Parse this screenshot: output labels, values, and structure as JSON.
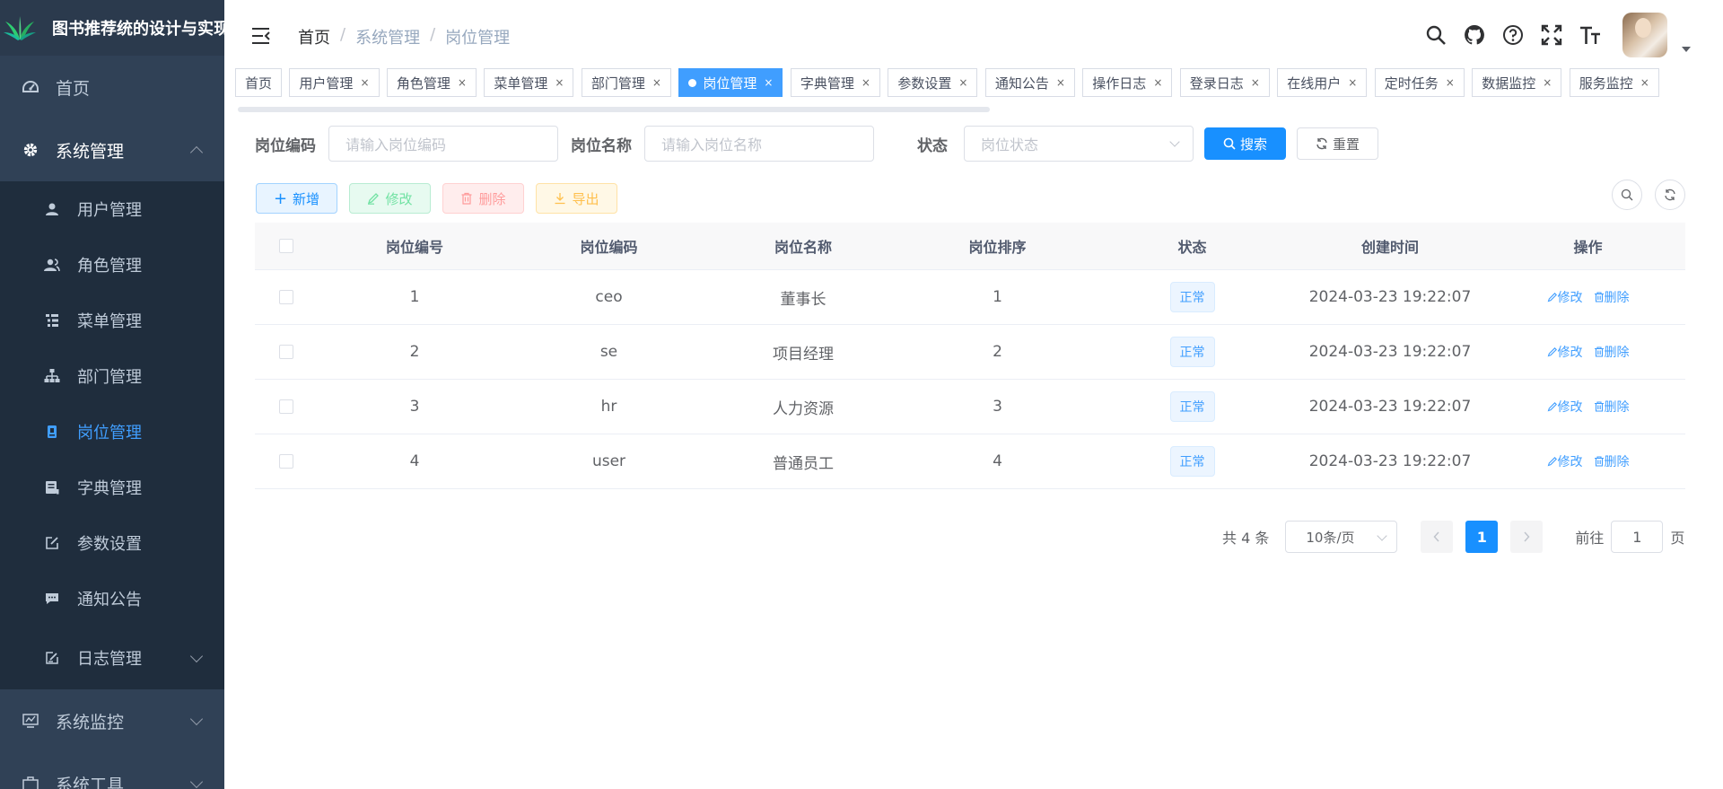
{
  "app": {
    "title": "图书推荐统的设计与实现"
  },
  "sidebar": {
    "items": [
      {
        "label": "首页"
      },
      {
        "label": "系统管理"
      },
      {
        "label": "系统监控"
      },
      {
        "label": "系统工具"
      }
    ],
    "sub_items": [
      {
        "label": "用户管理"
      },
      {
        "label": "角色管理"
      },
      {
        "label": "菜单管理"
      },
      {
        "label": "部门管理"
      },
      {
        "label": "岗位管理"
      },
      {
        "label": "字典管理"
      },
      {
        "label": "参数设置"
      },
      {
        "label": "通知公告"
      },
      {
        "label": "日志管理"
      }
    ]
  },
  "breadcrumb": [
    "首页",
    "/",
    "系统管理",
    "/",
    "岗位管理"
  ],
  "tags": [
    "首页",
    "用户管理",
    "角色管理",
    "菜单管理",
    "部门管理",
    "岗位管理",
    "字典管理",
    "参数设置",
    "通知公告",
    "操作日志",
    "登录日志",
    "在线用户",
    "定时任务",
    "数据监控",
    "服务监控"
  ],
  "tag_close": "×",
  "search": {
    "code_label": "岗位编码",
    "code_placeholder": "请输入岗位编码",
    "name_label": "岗位名称",
    "name_placeholder": "请输入岗位名称",
    "status_label": "状态",
    "status_placeholder": "岗位状态",
    "search_btn": "搜索",
    "reset_btn": "重置"
  },
  "toolbar": {
    "add": "新增",
    "edit": "修改",
    "delete": "删除",
    "export": "导出"
  },
  "table": {
    "headers": [
      "岗位编号",
      "岗位编码",
      "岗位名称",
      "岗位排序",
      "状态",
      "创建时间",
      "操作"
    ],
    "rows": [
      {
        "id": "1",
        "code": "ceo",
        "name": "董事长",
        "sort": "1",
        "status": "正常",
        "created": "2024-03-23 19:22:07"
      },
      {
        "id": "2",
        "code": "se",
        "name": "项目经理",
        "sort": "2",
        "status": "正常",
        "created": "2024-03-23 19:22:07"
      },
      {
        "id": "3",
        "code": "hr",
        "name": "人力资源",
        "sort": "3",
        "status": "正常",
        "created": "2024-03-23 19:22:07"
      },
      {
        "id": "4",
        "code": "user",
        "name": "普通员工",
        "sort": "4",
        "status": "正常",
        "created": "2024-03-23 19:22:07"
      }
    ],
    "op_edit": "修改",
    "op_delete": "删除"
  },
  "pagination": {
    "total": "共 4 条",
    "page_size": "10条/页",
    "current": "1",
    "goto_prefix": "前往",
    "goto_value": "1",
    "goto_suffix": "页"
  },
  "colors": {
    "primary": "#1890ff",
    "sidebar_bg": "#304156",
    "active_menu": "#409eff"
  }
}
